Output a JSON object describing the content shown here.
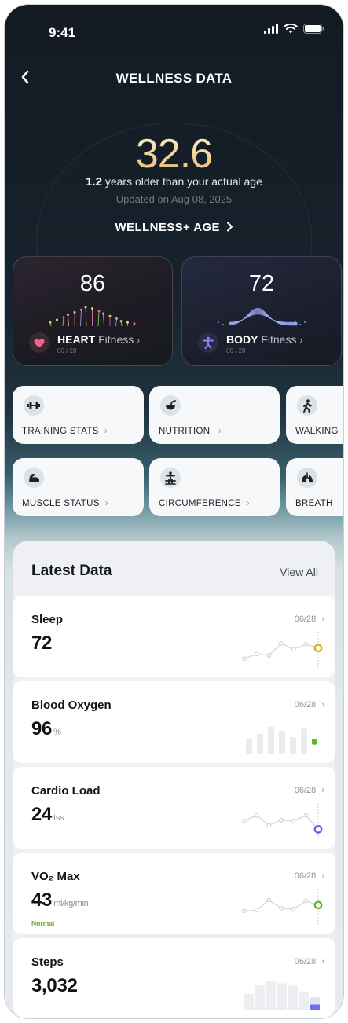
{
  "status_bar": {
    "time": "9:41"
  },
  "header": {
    "title": "WELLNESS DATA",
    "back_icon": "chevron-left-icon"
  },
  "hero": {
    "age": "32.6",
    "diff_value": "1.2",
    "diff_text": "years older than your actual age",
    "updated": "Updated on Aug 08, 2025",
    "link_label": "WELLNESS+ AGE"
  },
  "score_cards": [
    {
      "value": "86",
      "name": "HEART",
      "sub": "Fitness",
      "date": "06 / 28",
      "icon": "heart-icon",
      "accent": "#f06292"
    },
    {
      "value": "72",
      "name": "BODY",
      "sub": "Fitness",
      "date": "06 / 28",
      "icon": "person-stretch-icon",
      "accent": "#8a86ff"
    }
  ],
  "tiles": [
    {
      "label": "TRAINING STATS",
      "icon": "dumbbell-icon",
      "chevron": true
    },
    {
      "label": "NUTRITION",
      "icon": "bowl-icon",
      "chevron": true
    },
    {
      "label": "WALKING",
      "icon": "walking-icon",
      "chevron": false
    },
    {
      "label": "MUSCLE STATUS",
      "icon": "flexed-arm-icon",
      "chevron": true
    },
    {
      "label": "CIRCUMFERENCE",
      "icon": "body-measure-icon",
      "chevron": true
    },
    {
      "label": "BREATH",
      "icon": "lungs-icon",
      "chevron": false
    }
  ],
  "latest": {
    "title": "Latest Data",
    "view_all": "View All",
    "items": [
      {
        "name": "Sleep",
        "value": "72",
        "unit": "",
        "date": "06/28",
        "chart": "line",
        "accent": "#d6b21a",
        "points": [
          0.28,
          0.42,
          0.38,
          0.74,
          0.56,
          0.72,
          0.6
        ]
      },
      {
        "name": "Blood Oxygen",
        "value": "96",
        "unit": "%",
        "date": "06/28",
        "chart": "bars",
        "accent": "#5ab82a",
        "points": [
          0.45,
          0.6,
          0.82,
          0.7,
          0.5,
          0.75,
          0.4
        ]
      },
      {
        "name": "Cardio Load",
        "value": "24",
        "unit": "tss",
        "date": "06/28",
        "chart": "line",
        "accent": "#5a5ee8",
        "points": [
          0.55,
          0.72,
          0.42,
          0.58,
          0.55,
          0.72,
          0.3
        ]
      },
      {
        "name": "VO₂ Max",
        "value": "43",
        "unit": "ml/kg/min",
        "status": "Normal",
        "date": "06/28",
        "chart": "line",
        "accent": "#5ab82a",
        "points": [
          0.42,
          0.45,
          0.75,
          0.5,
          0.48,
          0.72,
          0.6
        ]
      },
      {
        "name": "Steps",
        "value": "3,032",
        "unit": "",
        "date": "06/28",
        "chart": "bars",
        "accent": "#6c6ef0",
        "points": [
          0.5,
          0.78,
          0.88,
          0.82,
          0.75,
          0.55,
          0.4
        ]
      }
    ]
  }
}
